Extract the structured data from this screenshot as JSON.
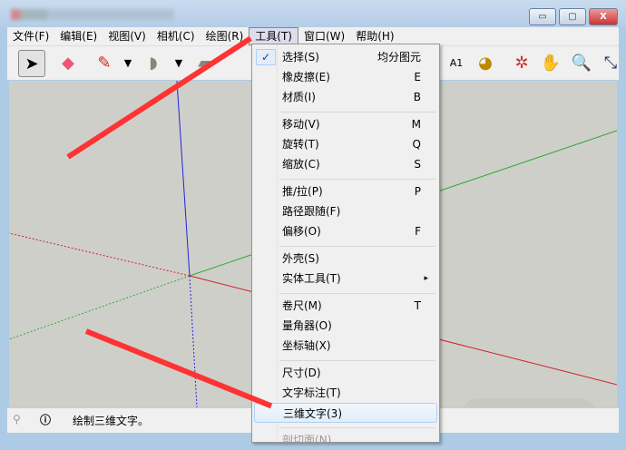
{
  "window": {
    "minimize": "▭",
    "restore": "▢",
    "close": "X"
  },
  "menubar": [
    "文件(F)",
    "编辑(E)",
    "视图(V)",
    "相机(C)",
    "绘图(R)",
    "工具(T)",
    "窗口(W)",
    "帮助(H)"
  ],
  "tools_menu": [
    {
      "label": "选择(S)",
      "shortcut": "均分图元",
      "checked": true
    },
    {
      "label": "橡皮擦(E)",
      "shortcut": "E"
    },
    {
      "label": "材质(I)",
      "shortcut": "B"
    },
    {
      "label": "移动(V)",
      "shortcut": "M"
    },
    {
      "label": "旋转(T)",
      "shortcut": "Q"
    },
    {
      "label": "缩放(C)",
      "shortcut": "S"
    },
    {
      "label": "推/拉(P)",
      "shortcut": "P"
    },
    {
      "label": "路径跟随(F)",
      "shortcut": ""
    },
    {
      "label": "偏移(O)",
      "shortcut": "F"
    },
    {
      "label": "外壳(S)",
      "shortcut": ""
    },
    {
      "label": "实体工具(T)",
      "shortcut": "▸"
    },
    {
      "label": "卷尺(M)",
      "shortcut": "T"
    },
    {
      "label": "量角器(O)",
      "shortcut": ""
    },
    {
      "label": "坐标轴(X)",
      "shortcut": ""
    },
    {
      "label": "尺寸(D)",
      "shortcut": ""
    },
    {
      "label": "文字标注(T)",
      "shortcut": ""
    },
    {
      "label": "三维文字(3)",
      "shortcut": ""
    },
    {
      "label": "剖切面(N)",
      "shortcut": ""
    }
  ],
  "status": {
    "text": "绘制三维文字。"
  },
  "colors": {
    "accent": "#ff3333",
    "viewport": "#cfcfca"
  }
}
